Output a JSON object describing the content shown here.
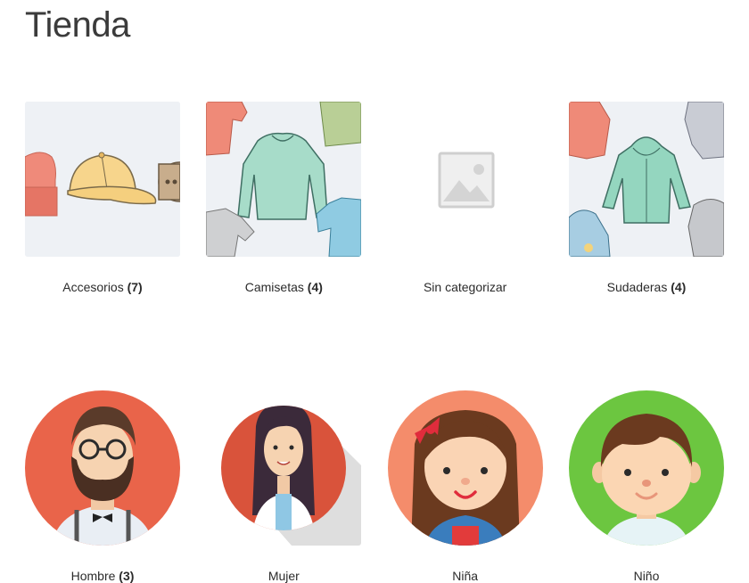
{
  "page": {
    "title": "Tienda"
  },
  "categories": [
    {
      "name": "Accesorios",
      "count": "(7)",
      "icon": "accessories-image"
    },
    {
      "name": "Camisetas",
      "count": "(4)",
      "icon": "tshirts-image"
    },
    {
      "name": "Sin categorizar",
      "count": "",
      "icon": "placeholder-image"
    },
    {
      "name": "Sudaderas",
      "count": "(4)",
      "icon": "hoodies-image"
    },
    {
      "name": "Hombre",
      "count": "(3)",
      "icon": "man-avatar-image"
    },
    {
      "name": "Mujer",
      "count": "",
      "icon": "woman-avatar-image"
    },
    {
      "name": "Niña",
      "count": "",
      "icon": "girl-avatar-image"
    },
    {
      "name": "Niño",
      "count": "",
      "icon": "boy-avatar-image"
    }
  ],
  "colors": {
    "thumb_bg": "#eef1f5",
    "man_circle": "#e9644a",
    "woman_circle": "#d9533b",
    "girl_circle": "#f48c6b",
    "boy_circle": "#6cc640"
  }
}
